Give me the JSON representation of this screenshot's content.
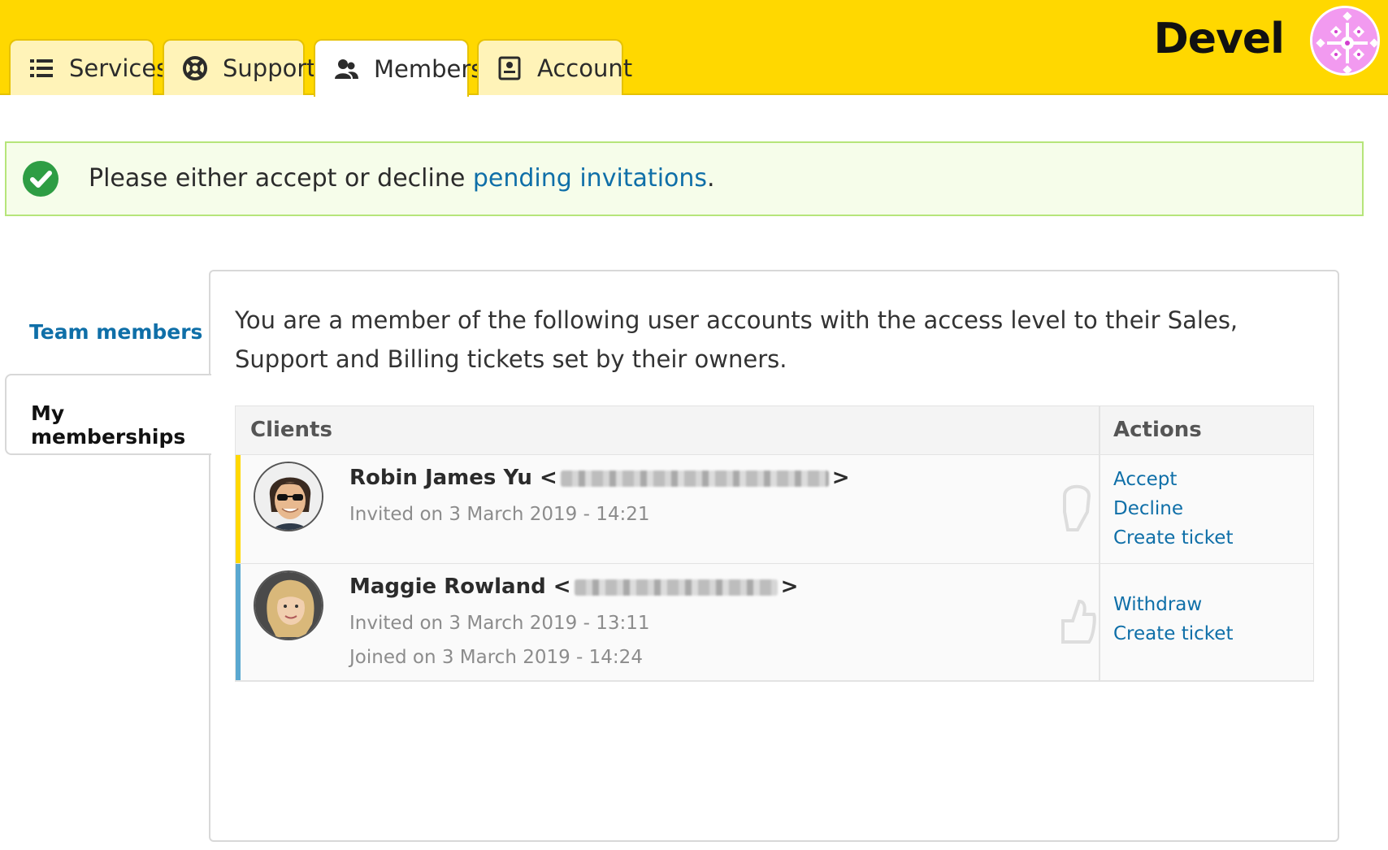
{
  "header": {
    "brand": "Devel",
    "tabs": [
      {
        "label": "Services",
        "icon": "list-icon"
      },
      {
        "label": "Support",
        "icon": "lifebuoy-icon"
      },
      {
        "label": "Members",
        "icon": "users-icon"
      },
      {
        "label": "Account",
        "icon": "contact-card-icon"
      }
    ],
    "active_tab": "Members",
    "accent_color": "#ffd800"
  },
  "alert": {
    "text_before": "Please either accept or decline ",
    "link_text": "pending invitations",
    "text_after": ".",
    "type": "success"
  },
  "sidebar": {
    "items": [
      {
        "label": "Team members"
      },
      {
        "label": "My memberships"
      }
    ],
    "active": "My memberships"
  },
  "main": {
    "intro": "You are a member of the following user accounts with the access level to their Sales, Support and Billing tickets set by their owners.",
    "table": {
      "headers": {
        "clients": "Clients",
        "actions": "Actions"
      },
      "rows": [
        {
          "name": "Robin James Yu",
          "email_open": "<",
          "email_close": ">",
          "invited": "Invited on 3 March 2019 - 14:21",
          "joined": "",
          "status_color": "#ffd800",
          "actions": [
            "Accept",
            "Decline",
            "Create ticket"
          ]
        },
        {
          "name": "Maggie Rowland",
          "email_open": "<",
          "email_close": ">",
          "invited": "Invited on 3 March 2019 - 13:11",
          "joined": "Joined on 3 March 2019 - 14:24",
          "status_color": "#5aa8d0",
          "actions": [
            "Withdraw",
            "Create ticket"
          ]
        }
      ]
    }
  }
}
